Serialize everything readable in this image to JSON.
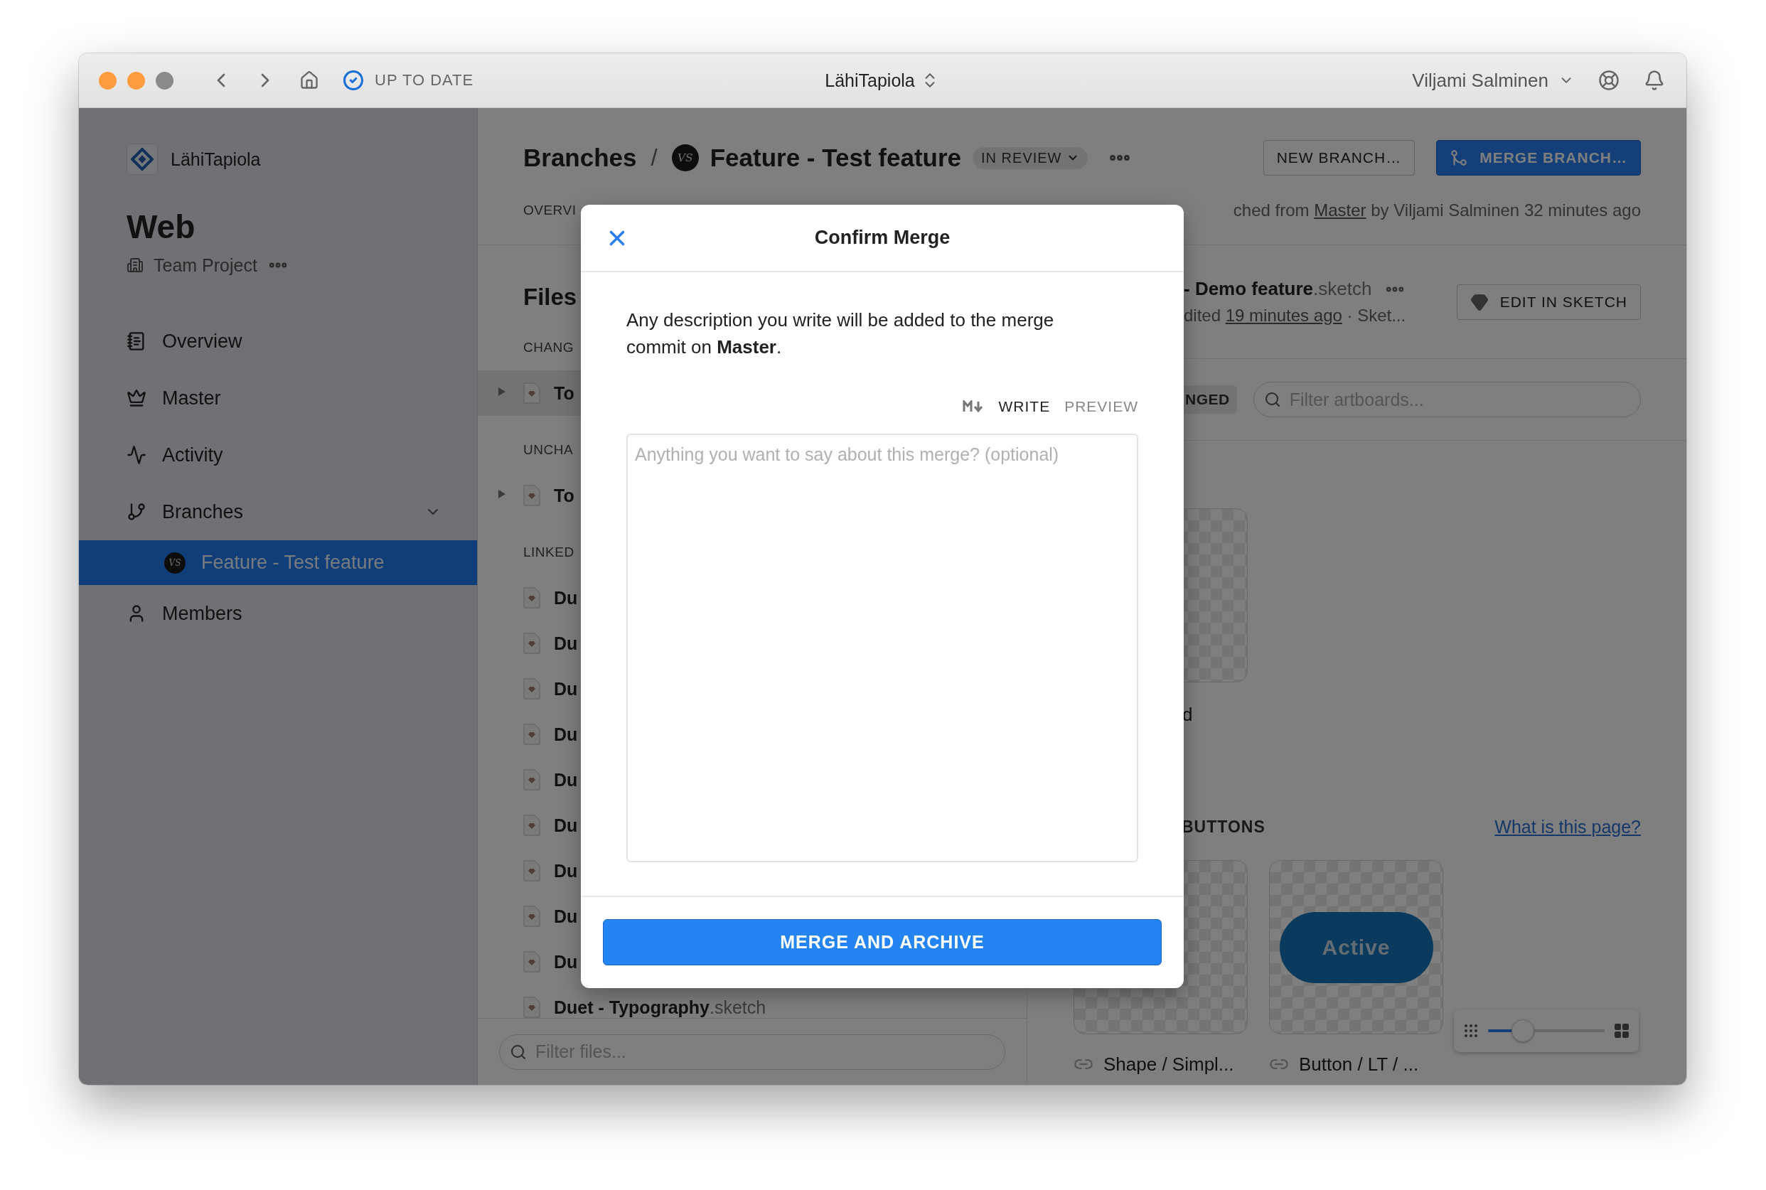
{
  "titlebar": {
    "sync_status": "UP TO DATE",
    "workspace": "LähiTapiola",
    "user": "Viljami Salminen"
  },
  "sidebar": {
    "organization": "LähiTapiola",
    "project": "Web",
    "project_type": "Team Project",
    "items": [
      {
        "label": "Overview",
        "selected": false
      },
      {
        "label": "Master",
        "selected": false
      },
      {
        "label": "Activity",
        "selected": false
      },
      {
        "label": "Branches",
        "selected": false,
        "expanded": true,
        "children": [
          {
            "label": "Feature - Test feature",
            "avatar": "VS",
            "selected": true
          }
        ]
      },
      {
        "label": "Members",
        "selected": false
      }
    ]
  },
  "header": {
    "breadcrumb": "Branches",
    "separator": "/",
    "branch_avatar": "VS",
    "branch": "Feature - Test feature",
    "status": "IN REVIEW",
    "buttons": [
      {
        "label": "NEW BRANCH…",
        "kind": "secondary"
      },
      {
        "label": "MERGE BRANCH…",
        "kind": "primary"
      }
    ],
    "tab_fragment": "OVERVI",
    "meta": {
      "prefix": "ched from",
      "link": "Master",
      "suffix": "by Viljami Salminen 32 minutes ago"
    }
  },
  "files": {
    "title": "Files",
    "sections": [
      {
        "label": "CHANG",
        "items": [
          {
            "name": "To",
            "expanded": false,
            "selected": true
          }
        ]
      },
      {
        "label": "UNCHA",
        "items": [
          {
            "name": "To",
            "expanded": false,
            "selected": false
          }
        ]
      },
      {
        "label": "LINKED",
        "items": [
          {
            "name": "Du",
            "selected": false
          },
          {
            "name": "Du",
            "selected": false
          },
          {
            "name": "Du",
            "selected": false
          },
          {
            "name": "Du",
            "selected": false
          },
          {
            "name": "Du",
            "selected": false
          },
          {
            "name": "Du",
            "selected": false
          },
          {
            "name": "Du",
            "selected": false
          },
          {
            "name": "Du",
            "selected": false
          },
          {
            "name": "Du",
            "selected": false
          },
          {
            "name": "Duet - Typography",
            "ext": ".sketch",
            "selected": false
          }
        ]
      }
    ],
    "filter_placeholder": "Filter files..."
  },
  "document": {
    "name": "- Demo feature",
    "ext": ".sketch",
    "meta": {
      "prefix": "dited",
      "link": "19 minutes ago",
      "suffix": "· Sket..."
    },
    "edit_button": "EDIT IN SKETCH"
  },
  "filter_bar": {
    "tag": "NGED",
    "placeholder": "Filter artboards..."
  },
  "artboards": {
    "top_label": "d",
    "section": "BUTTONS",
    "help_link": "What is this page?",
    "cards": [
      {
        "label": "Shape / Simpl..."
      },
      {
        "label": "Button / LT / ...",
        "preview_text": "Active"
      }
    ],
    "zoom": {
      "level": 0.3
    }
  },
  "modal": {
    "title": "Confirm Merge",
    "description": "Any description you write will be added to the merge commit on **Master**.",
    "editor_tabs": [
      {
        "label": "WRITE",
        "selected": true
      },
      {
        "label": "PREVIEW",
        "selected": false
      }
    ],
    "placeholder": "Anything you want to say about this merge? (optional)",
    "submit": "MERGE AND ARCHIVE"
  }
}
